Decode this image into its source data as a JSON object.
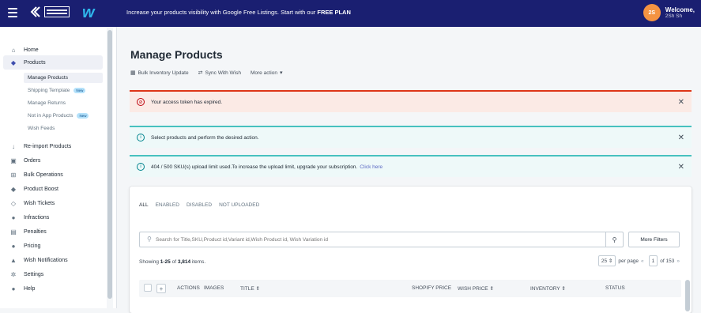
{
  "topbar": {
    "promo_text": "Increase your products visibility with Google Free Listings. Start with our",
    "promo_bold": "FREE PLAN",
    "avatar_initials": "2S",
    "welcome": "Welcome,",
    "welcome_sub": "2Sh Sh",
    "brand_color": "#1a1f71"
  },
  "sidebar": {
    "items": [
      {
        "label": "Home",
        "icon": "home-icon"
      },
      {
        "label": "Products",
        "icon": "tag-icon"
      },
      {
        "label": "Re-import Products",
        "icon": "download-icon"
      },
      {
        "label": "Orders",
        "icon": "inbox-icon"
      },
      {
        "label": "Bulk Operations",
        "icon": "grid-icon"
      },
      {
        "label": "Product Boost",
        "icon": "tag-icon"
      },
      {
        "label": "Wish Tickets",
        "icon": "tag-icon"
      },
      {
        "label": "Infractions",
        "icon": "alert-icon"
      },
      {
        "label": "Penalties",
        "icon": "document-icon"
      },
      {
        "label": "Pricing",
        "icon": "dollar-icon"
      },
      {
        "label": "Wish Notifications",
        "icon": "bell-icon"
      },
      {
        "label": "Settings",
        "icon": "gear-icon"
      },
      {
        "label": "Help",
        "icon": "help-icon"
      }
    ],
    "sub_items": [
      {
        "label": "Manage Products"
      },
      {
        "label": "Shipping Template",
        "badge": "New"
      },
      {
        "label": "Manage Returns"
      },
      {
        "label": "Not in App Products",
        "badge": "New"
      },
      {
        "label": "Wish Feeds"
      }
    ]
  },
  "main": {
    "title": "Manage Products",
    "actions": [
      "Bulk Inventory Update",
      "Sync With Wish",
      "More action"
    ],
    "banners": {
      "error": "Your access token has expired.",
      "info1": "Select products and perform the desired action.",
      "info2": "404 / 500 SKU(s) upload limit used.To increase the upload limit, upgrade your subscription.",
      "info2_link": "Click here"
    },
    "tabs": [
      "ALL",
      "ENABLED",
      "DISABLED",
      "NOT UPLOADED"
    ],
    "search": {
      "placeholder": "Search for Title,SKU,Product id,Variant id,Wish Product id, Wish Variation id",
      "more_filters": "More Filters"
    },
    "showing": {
      "prefix": "Showing",
      "range": "1-25",
      "of": "of",
      "total": "3,814",
      "suffix": "items."
    },
    "pager": {
      "per_page_value": "25",
      "per_page_label": "per page",
      "page": "1",
      "of_pages": "of 153"
    },
    "table_headers": [
      "ACTIONS",
      "IMAGES",
      "TITLE ⇕",
      "SHOPIFY PRICE",
      "WISH PRICE ⇕",
      "INVENTORY ⇕",
      "STATUS"
    ]
  }
}
